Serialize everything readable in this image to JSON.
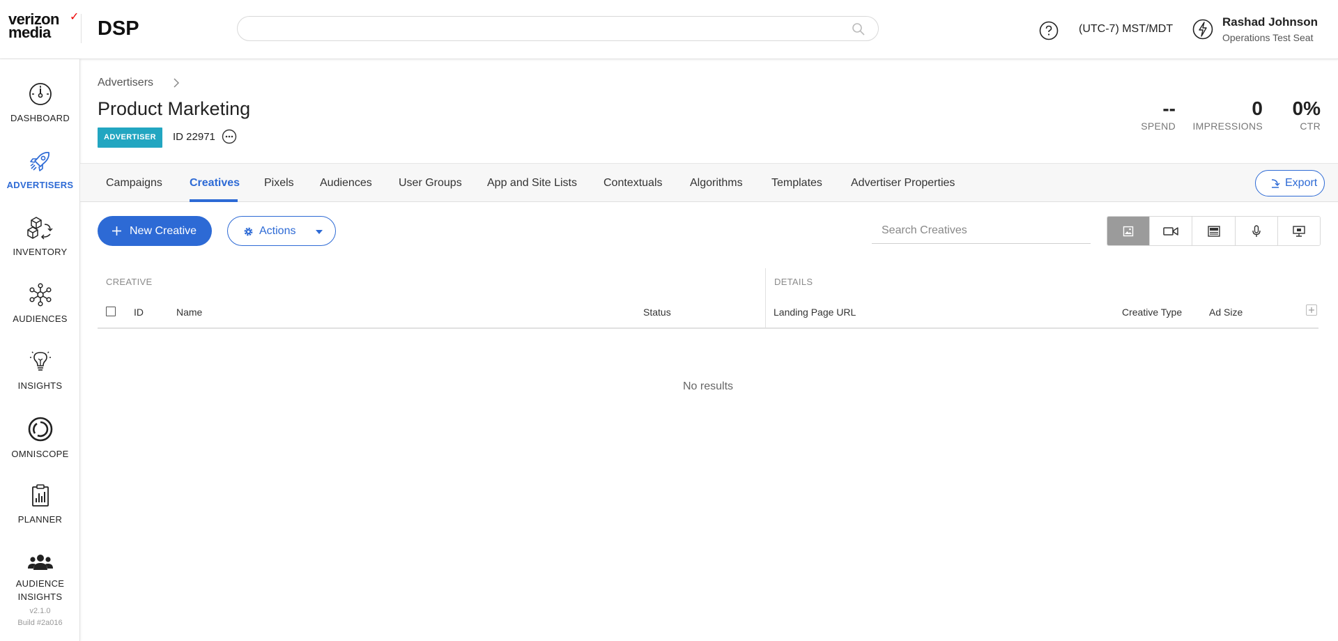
{
  "brand": {
    "logo_line1": "verizon",
    "logo_check": "✓",
    "logo_line2": "media",
    "app_name": "DSP"
  },
  "header": {
    "search_placeholder": "",
    "timezone": "(UTC-7) MST/MDT",
    "user_name": "Rashad Johnson",
    "user_seat": "Operations Test Seat"
  },
  "nav": {
    "items": [
      {
        "label": "DASHBOARD",
        "icon": "dashboard-icon",
        "active": false
      },
      {
        "label": "ADVERTISERS",
        "icon": "rocket-icon",
        "active": true
      },
      {
        "label": "INVENTORY",
        "icon": "inventory-cubes-icon",
        "active": false
      },
      {
        "label": "AUDIENCES",
        "icon": "network-icon",
        "active": false
      },
      {
        "label": "INSIGHTS",
        "icon": "lightbulb-icon",
        "active": false
      },
      {
        "label": "OMNISCOPE",
        "icon": "omniscope-icon",
        "active": false
      },
      {
        "label": "PLANNER",
        "icon": "clipboard-icon",
        "active": false
      },
      {
        "label": "AUDIENCE INSIGHTS",
        "label_line1": "AUDIENCE",
        "label_line2": "INSIGHTS",
        "icon": "people-icon",
        "active": false
      }
    ],
    "version": "v2.1.0",
    "build": "Build #2a016"
  },
  "page": {
    "breadcrumb": "Advertisers",
    "title": "Product Marketing",
    "badge": "ADVERTISER",
    "id_text": "ID 22971"
  },
  "stats": [
    {
      "value": "--",
      "label": "SPEND"
    },
    {
      "value": "0",
      "label": "IMPRESSIONS"
    },
    {
      "value": "0%",
      "label": "CTR"
    }
  ],
  "tabs": [
    {
      "label": "Campaigns",
      "active": false
    },
    {
      "label": "Creatives",
      "active": true
    },
    {
      "label": "Pixels",
      "active": false
    },
    {
      "label": "Audiences",
      "active": false
    },
    {
      "label": "User Groups",
      "active": false
    },
    {
      "label": "App and Site Lists",
      "active": false
    },
    {
      "label": "Contextuals",
      "active": false
    },
    {
      "label": "Algorithms",
      "active": false
    },
    {
      "label": "Templates",
      "active": false
    },
    {
      "label": "Advertiser Properties",
      "active": false
    }
  ],
  "export_label": "Export",
  "toolbar": {
    "new_label": "New Creative",
    "actions_label": "Actions",
    "search_placeholder": "Search Creatives",
    "format_filters": [
      "image-icon",
      "video-icon",
      "native-icon",
      "audio-icon",
      "display-icon"
    ],
    "selected_format": "image-icon"
  },
  "table": {
    "group_creative": "CREATIVE",
    "group_details": "DETAILS",
    "columns": {
      "id": "ID",
      "name": "Name",
      "status": "Status",
      "landing_url": "Landing Page URL",
      "creative_type": "Creative Type",
      "ad_size": "Ad Size"
    },
    "rows": [],
    "empty_message": "No results"
  }
}
